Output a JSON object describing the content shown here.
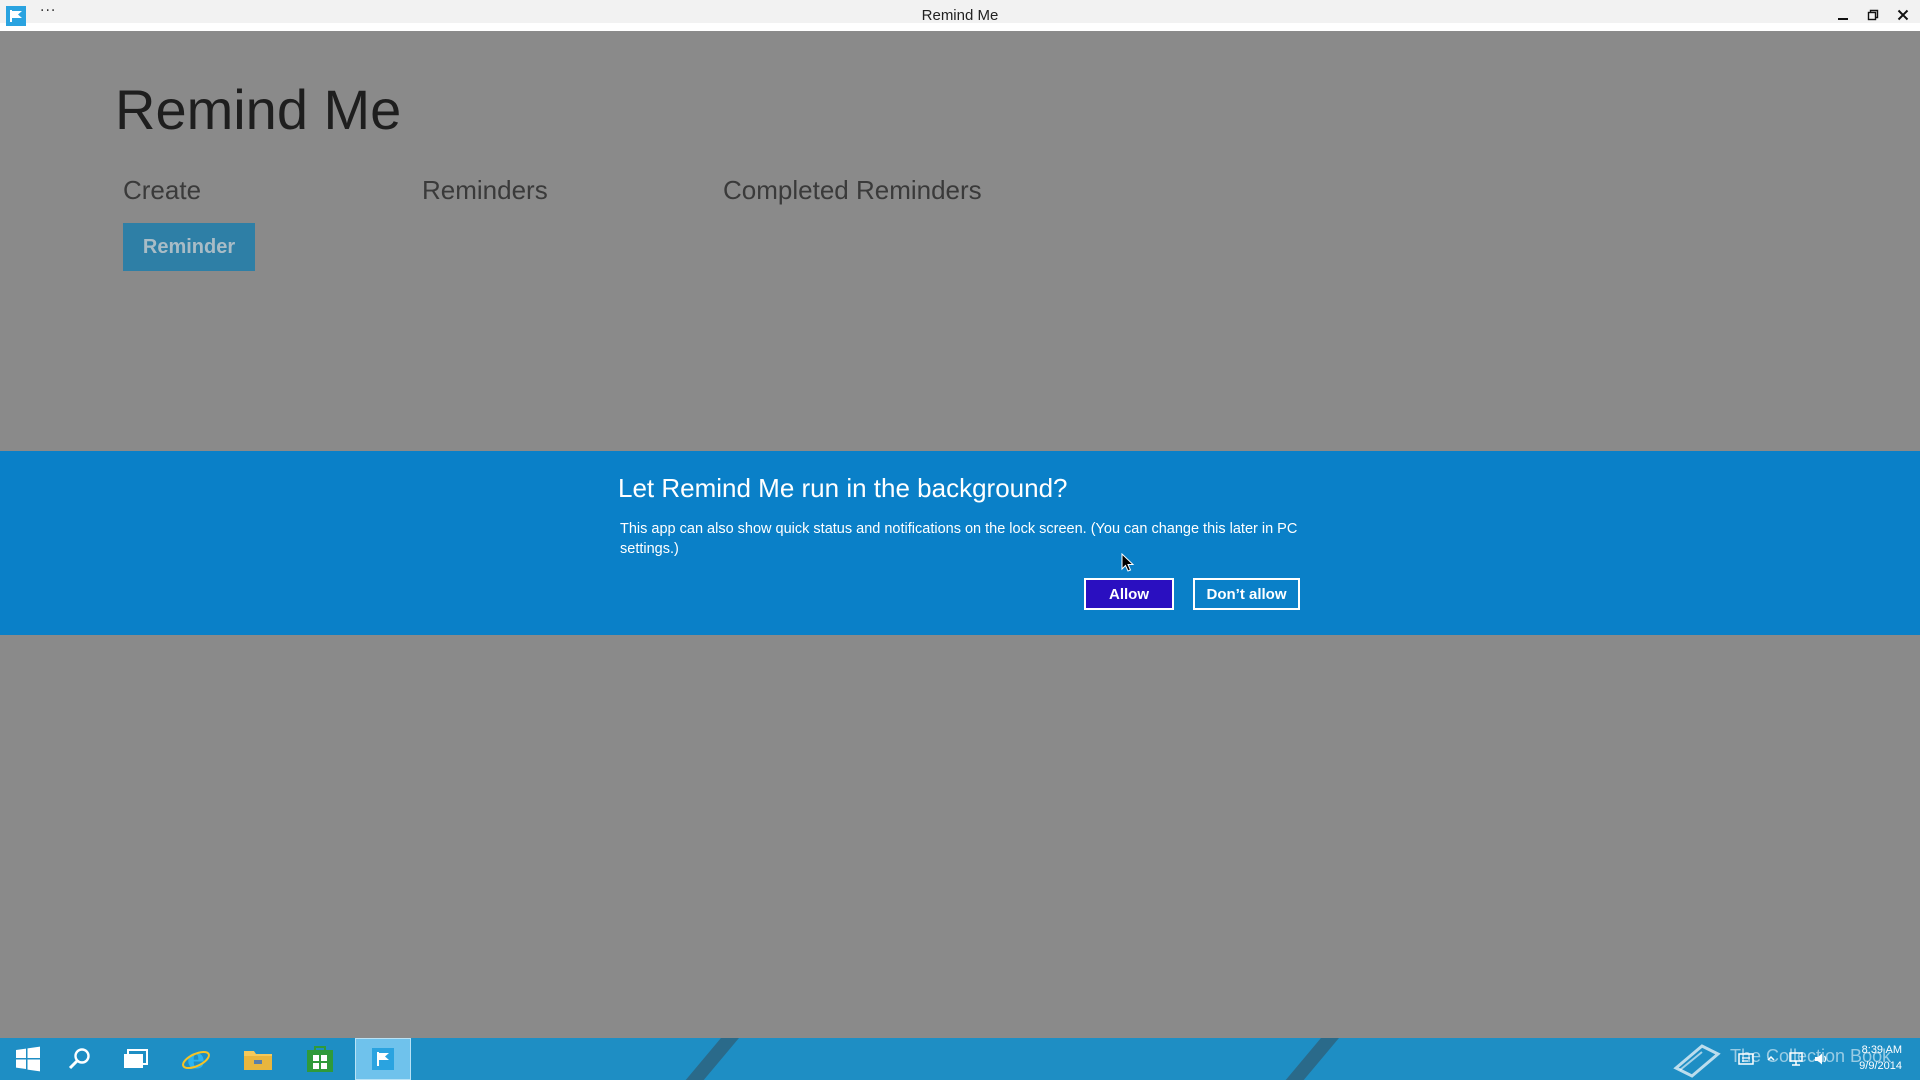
{
  "window": {
    "title": "Remind Me",
    "menu": "···"
  },
  "app": {
    "title": "Remind Me",
    "sections": {
      "create": "Create",
      "reminders": "Reminders",
      "completed": "Completed Reminders"
    },
    "reminder_button": "Reminder"
  },
  "dialog": {
    "title": "Let Remind Me run in the background?",
    "body": "This app can also show quick status and notifications on the lock screen. (You can change this later in PC settings.)",
    "allow": "Allow",
    "deny": "Don’t allow"
  },
  "taskbar": {
    "watermark": "The Collection Book",
    "time": "8:39 AM",
    "date": "9/9/2014"
  },
  "colors": {
    "dialog_bg": "#0a80c8",
    "allow_bg": "#2a0fc0",
    "accent_button": "#2e7fa6",
    "taskbar": "#1e8ec4"
  }
}
